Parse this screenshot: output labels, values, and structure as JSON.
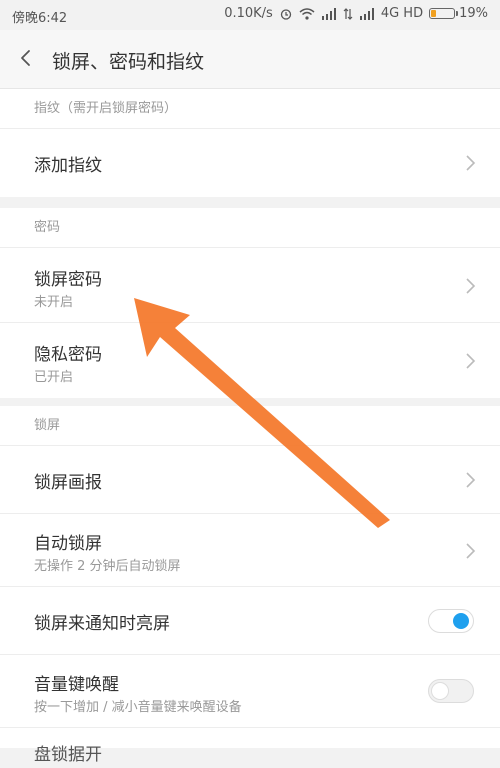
{
  "status_bar": {
    "time": "傍晚6:42",
    "network_speed": "0.10K/s",
    "network_type": "4G HD",
    "battery": "19%"
  },
  "header": {
    "title": "锁屏、密码和指纹"
  },
  "sections": {
    "fingerprint": {
      "header": "指纹（需开启锁屏密码）",
      "add_fingerprint": "添加指纹"
    },
    "password": {
      "header": "密码",
      "lock_password": {
        "label": "锁屏密码",
        "sub": "未开启"
      },
      "privacy_password": {
        "label": "隐私密码",
        "sub": "已开启"
      }
    },
    "lockscreen": {
      "header": "锁屏",
      "lock_magazine": "锁屏画报",
      "auto_lock": {
        "label": "自动锁屏",
        "sub": "无操作 2 分钟后自动锁屏"
      },
      "notify_wake": {
        "label": "锁屏来通知时亮屏",
        "enabled": true
      },
      "volume_wake": {
        "label": "音量键唤醒",
        "sub": "按一下增加 / 减小音量键来唤醒设备",
        "enabled": false
      },
      "partial_label": "盘锁据开"
    }
  },
  "colors": {
    "annotation_arrow": "#f47a2e",
    "toggle_on": "#1fa0ee"
  }
}
